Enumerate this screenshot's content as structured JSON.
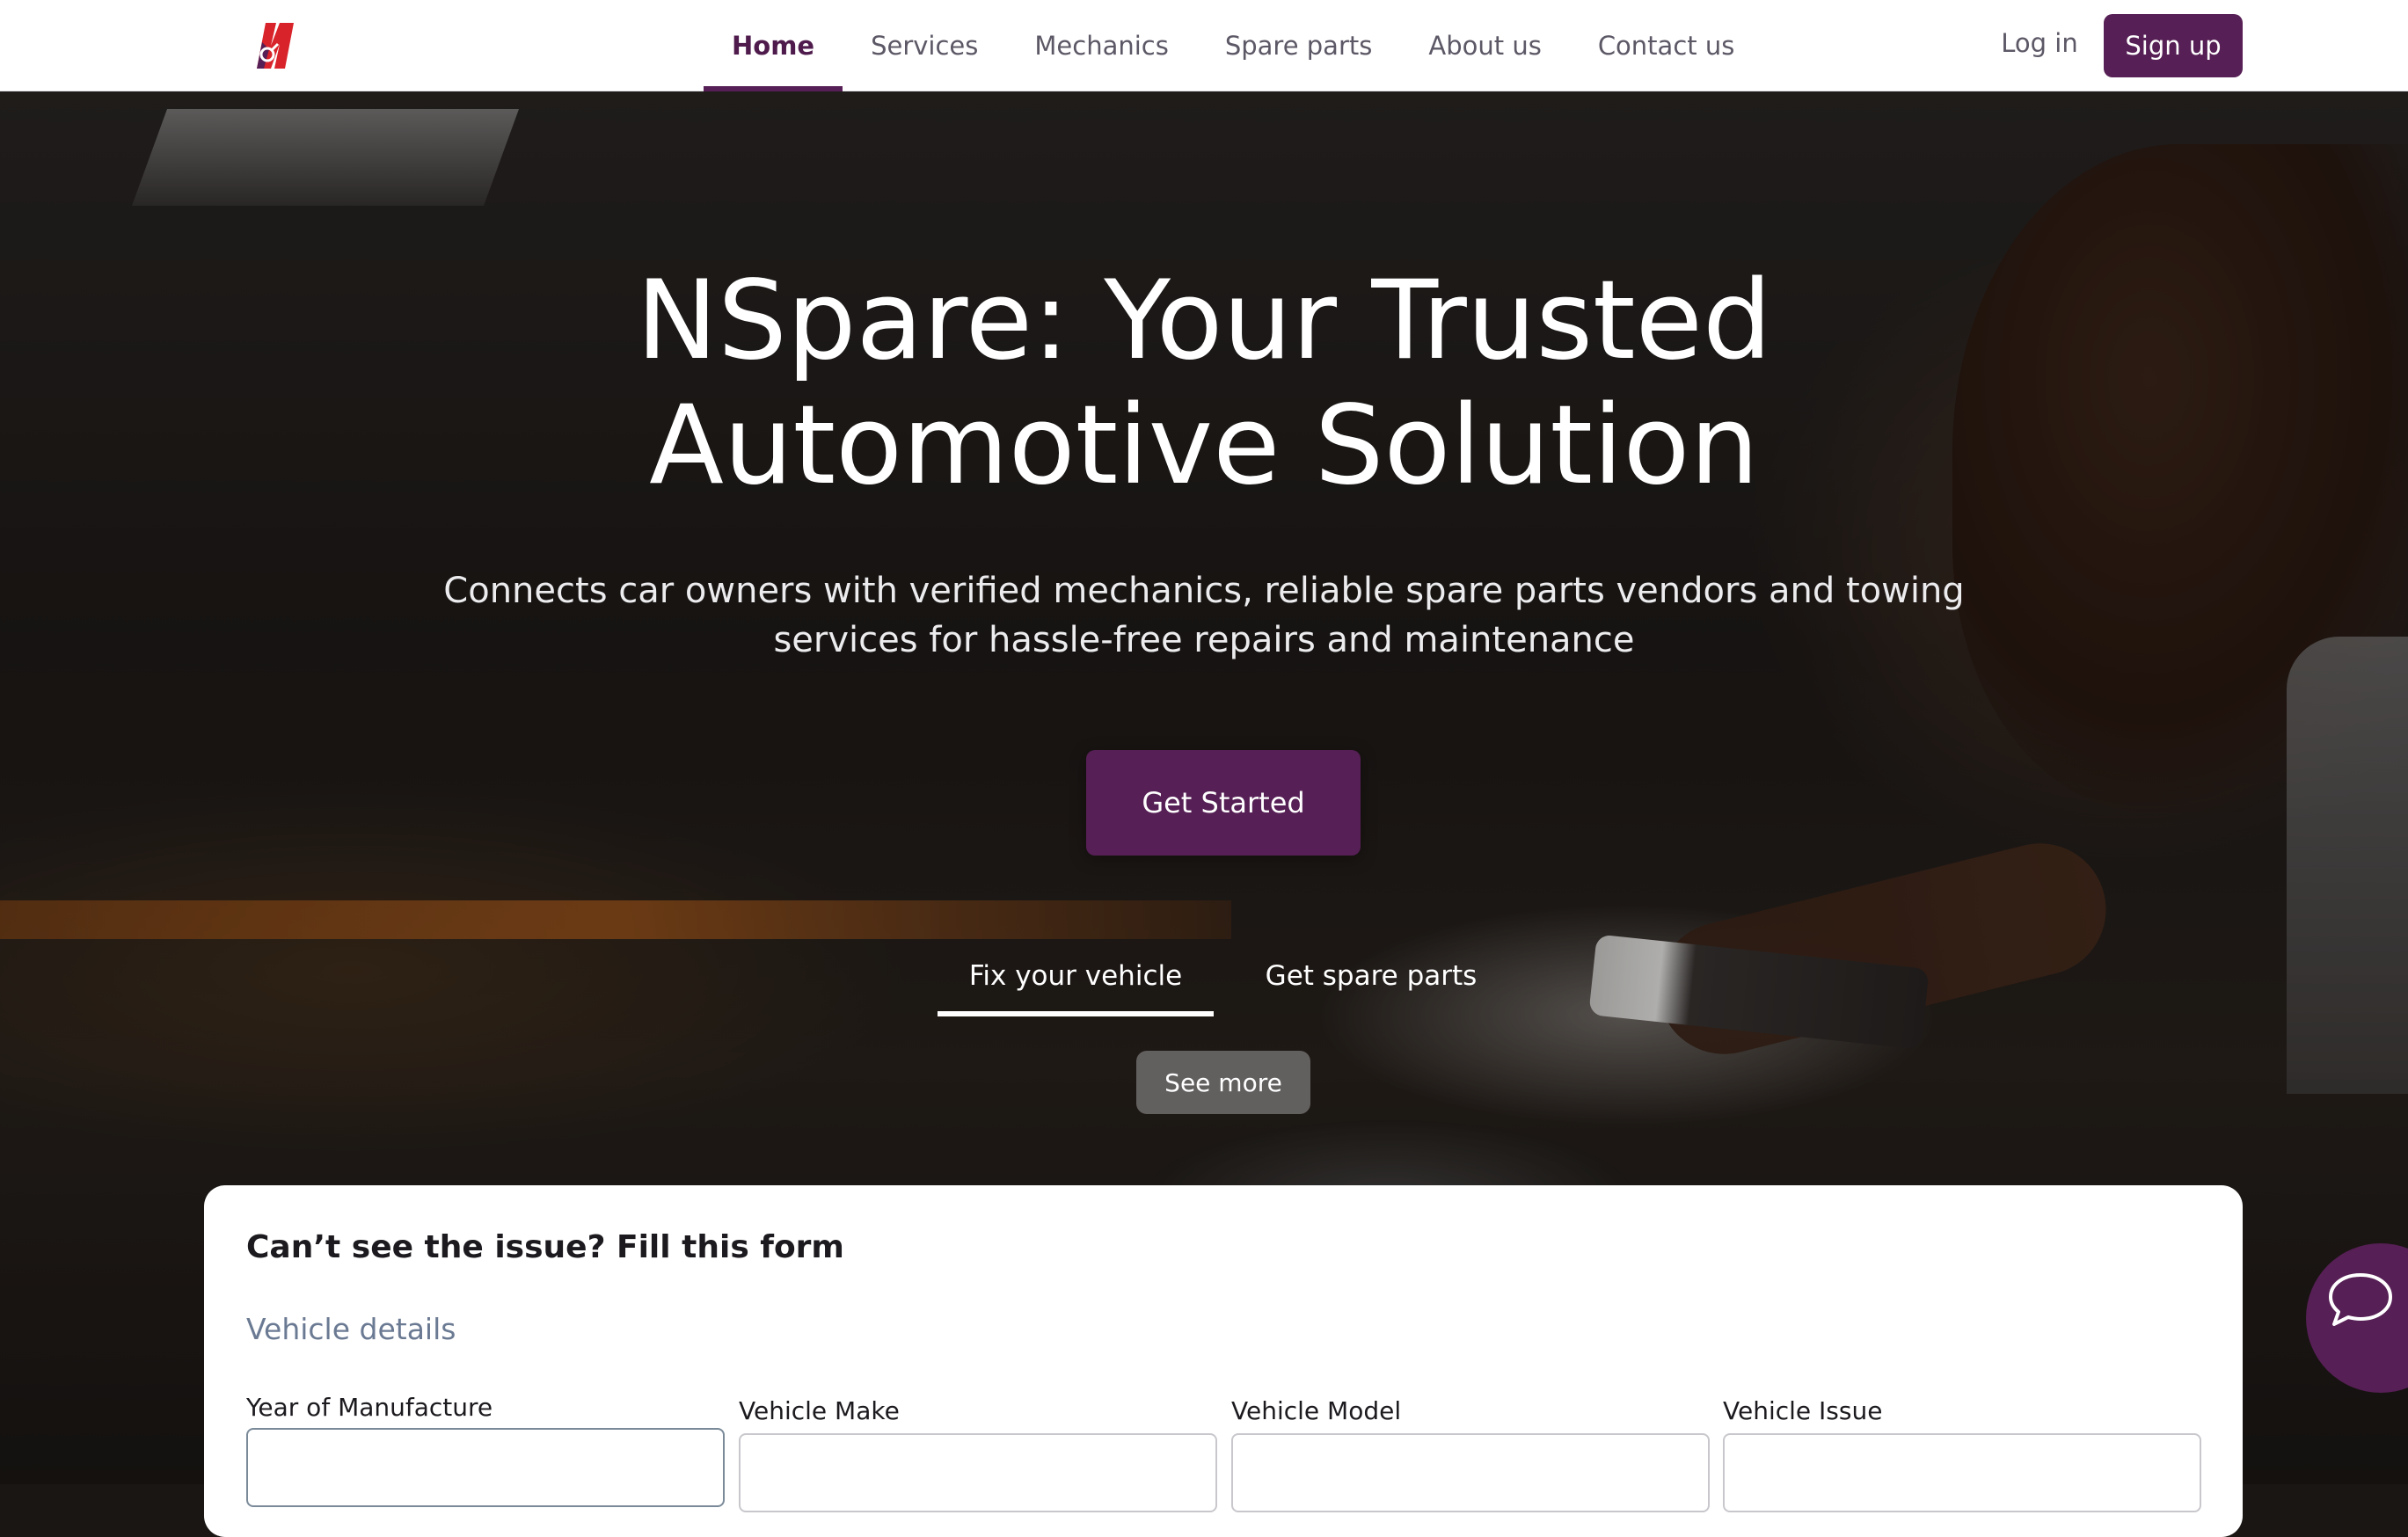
{
  "header": {
    "logo_icon": "nspare-logo-icon",
    "nav": [
      {
        "label": "Home",
        "active": true
      },
      {
        "label": "Services",
        "active": false
      },
      {
        "label": "Mechanics",
        "active": false
      },
      {
        "label": "Spare parts",
        "active": false
      },
      {
        "label": "About us",
        "active": false
      },
      {
        "label": "Contact us",
        "active": false
      }
    ],
    "login_label": "Log in",
    "signup_label": "Sign up"
  },
  "hero": {
    "title_line1": "NSpare: Your Trusted",
    "title_line2": "Automotive Solution",
    "subtitle_line1": "Connects car owners with verified mechanics, reliable spare parts vendors and towing",
    "subtitle_line2": "services for hassle-free repairs and maintenance",
    "cta_label": "Get Started",
    "tabs": [
      {
        "label": "Fix your vehicle",
        "active": true
      },
      {
        "label": "Get spare parts",
        "active": false
      }
    ],
    "see_more_label": "See more"
  },
  "form": {
    "title": "Can’t see the issue? Fill this form",
    "section": "Vehicle details",
    "fields": [
      {
        "label": "Year of Manufacture",
        "value": ""
      },
      {
        "label": "Vehicle Make",
        "value": ""
      },
      {
        "label": "Vehicle Model",
        "value": ""
      },
      {
        "label": "Vehicle Issue",
        "value": ""
      }
    ]
  },
  "chat": {
    "icon": "chat-bubble-icon"
  },
  "colors": {
    "brand": "#561f55",
    "nav_active": "#4e1b4c",
    "logo_red": "#d8232a",
    "section_label": "#6b7a93"
  }
}
